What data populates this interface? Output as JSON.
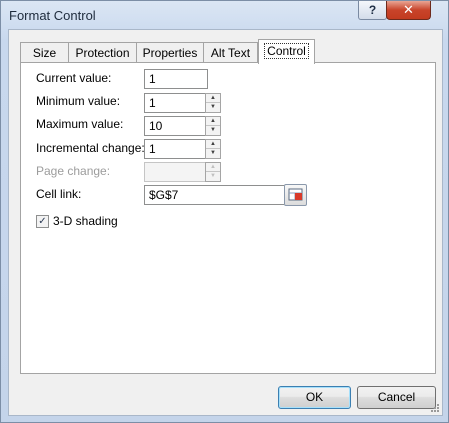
{
  "window": {
    "title": "Format Control",
    "help_label": "?",
    "close_label": "✕"
  },
  "tabs": [
    {
      "label": "Size"
    },
    {
      "label": "Protection"
    },
    {
      "label": "Properties"
    },
    {
      "label": "Alt Text"
    },
    {
      "label": "Control",
      "active": true
    }
  ],
  "fields": {
    "current_value": {
      "label": "Current value:",
      "value": "1"
    },
    "minimum_value": {
      "label": "Minimum value:",
      "value": "1"
    },
    "maximum_value": {
      "label": "Maximum value:",
      "value": "10"
    },
    "incremental_change": {
      "label": "Incremental change:",
      "value": "1"
    },
    "page_change": {
      "label": "Page change:",
      "value": "",
      "disabled": true
    },
    "cell_link": {
      "label": "Cell link:",
      "value": "$G$7"
    }
  },
  "shading": {
    "label": "3-D shading",
    "checked": true,
    "check_glyph": "✓"
  },
  "icons": {
    "spin_up": "▲",
    "spin_down": "▼",
    "ref": "range-select-icon"
  },
  "buttons": {
    "ok": "OK",
    "cancel": "Cancel"
  }
}
